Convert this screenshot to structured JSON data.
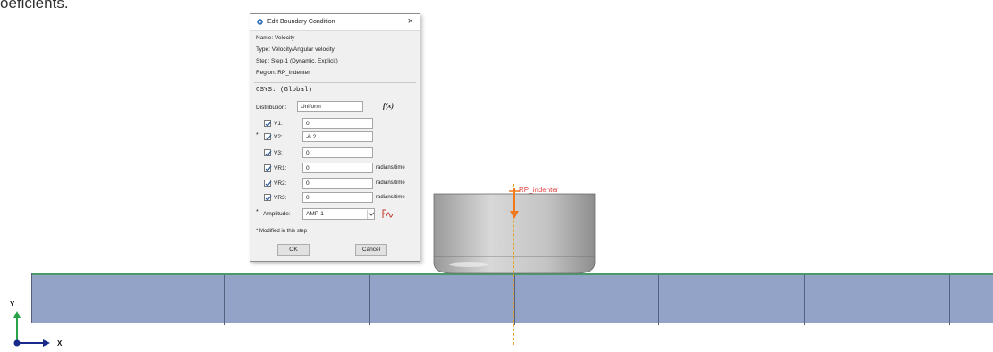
{
  "caption": "oeficients.",
  "dialog": {
    "title": "Edit Boundary Condition",
    "close_glyph": "×",
    "info": {
      "name_label": "Name:",
      "name_value": "Velocity",
      "type_label": "Type:",
      "type_value": "Velocity/Angular velocity",
      "step_label": "Step:",
      "step_value": "Step-1 (Dynamic, Explicit)",
      "region_label": "Region:",
      "region_value": "RP_indenter"
    },
    "csys": "CSYS: (Global)",
    "distribution_label": "Distribution:",
    "distribution_value": "Uniform",
    "fx_label": "f(x)",
    "fields": [
      {
        "star": "",
        "label": "V1:",
        "value": "0",
        "unit": "",
        "checked": true
      },
      {
        "star": "*",
        "label": "V2:",
        "value": "-6.2",
        "unit": "",
        "checked": true
      },
      {
        "star": "",
        "label": "V3:",
        "value": "0",
        "unit": "",
        "checked": true
      },
      {
        "star": "",
        "label": "VR1:",
        "value": "0",
        "unit": "radians/time",
        "checked": true
      },
      {
        "star": "",
        "label": "VR2:",
        "value": "0",
        "unit": "radians/time",
        "checked": true
      },
      {
        "star": "",
        "label": "VR3:",
        "value": "0",
        "unit": "radians/time",
        "checked": true
      }
    ],
    "amplitude_star": "*",
    "amplitude_label": "Amplitude:",
    "amplitude_value": "AMP-1",
    "modified_note": "* Modified in this step",
    "ok_label": "OK",
    "cancel_label": "Cancel"
  },
  "viewport": {
    "ref_point_label": "RP_indenter",
    "axis_y_label": "Y",
    "axis_x_label": "X",
    "colors": {
      "plate": "#93a3c8",
      "indenter": "#c0c0c0",
      "ref_point": "#e04040",
      "symmetry_line": "#e2a52a",
      "load_arrow": "#f07a1a"
    }
  }
}
